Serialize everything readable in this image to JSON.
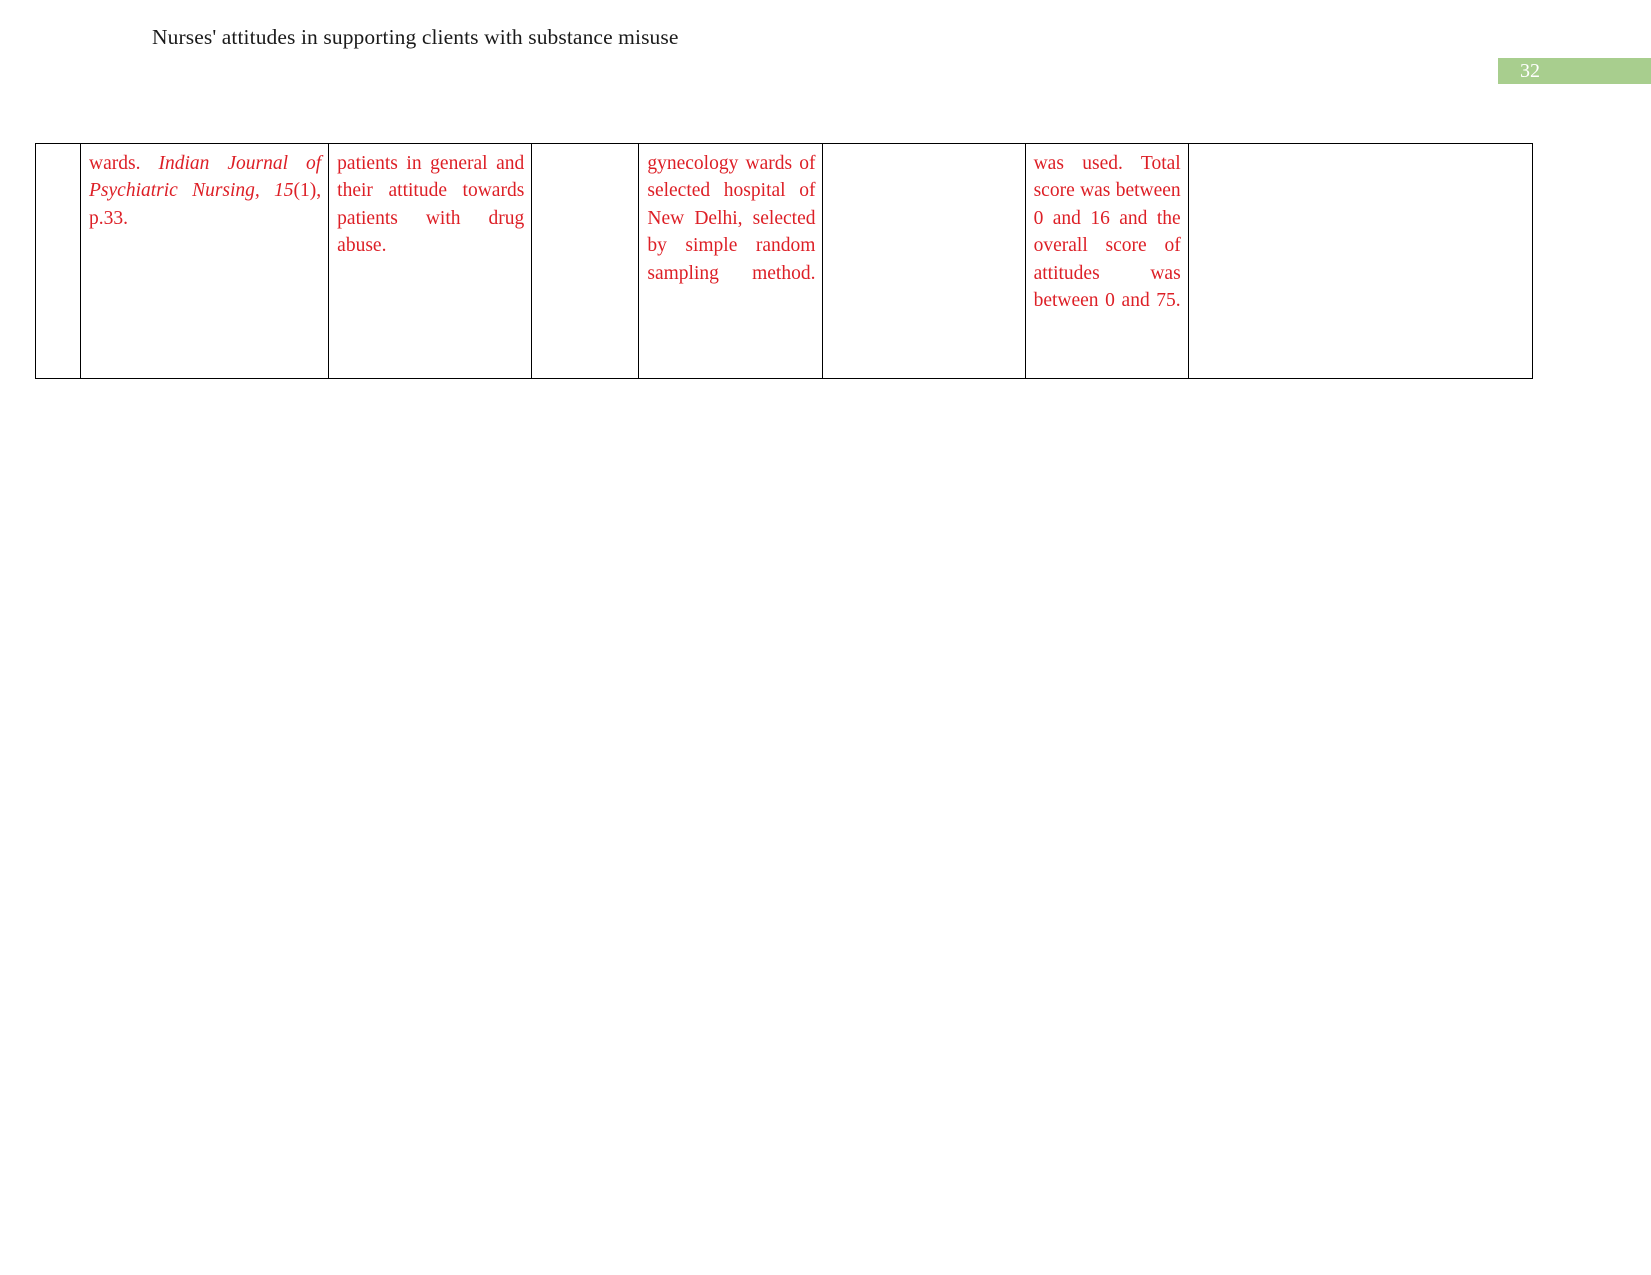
{
  "header": {
    "running_title": "Nurses' attitudes in supporting clients with substance misuse"
  },
  "page_number_band": {
    "number": "32",
    "band_color": "#a8ce8e",
    "text_color": "#ffffff"
  },
  "table": {
    "text_color": "#dd1f26",
    "border_color": "#000000",
    "columns": 7,
    "rows": [
      {
        "cells": {
          "num": "",
          "reference_prefix": "wards. ",
          "reference_italic": "Indian Journal of Psychiatric Nursing, 15",
          "reference_suffix": "(1), p.33.",
          "aim": "patients in general and their attitude towards patients with drug abuse.",
          "design": "",
          "sample": "gynecology wards of selected hospital of New Delhi, selected by simple random sampling method.",
          "analysis": "",
          "tool": "was used. Total score was between 0 and 16 and the overall score of attitudes was between 0 and 75.",
          "findings": ""
        }
      }
    ]
  }
}
